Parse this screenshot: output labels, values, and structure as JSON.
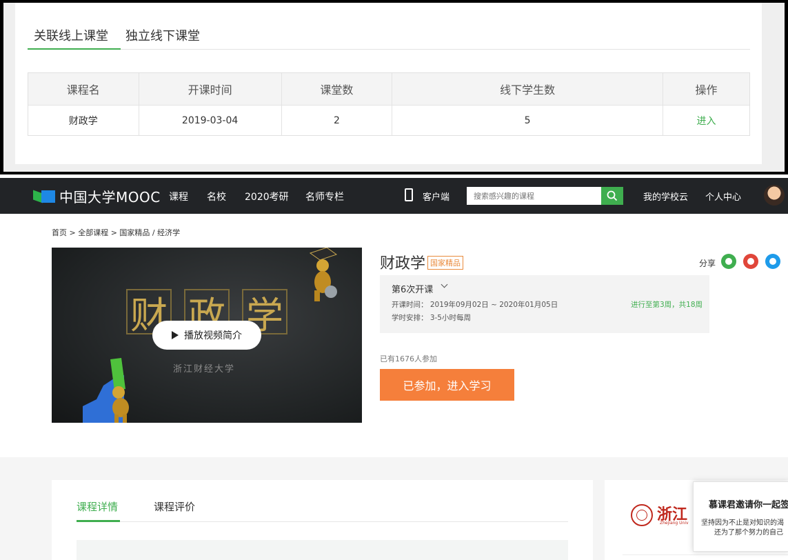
{
  "top": {
    "tabs": [
      "关联线上课堂",
      "独立线下课堂"
    ],
    "table": {
      "headers": [
        "课程名",
        "开课时间",
        "课堂数",
        "线下学生数",
        "操作"
      ],
      "rows": [
        {
          "name": "财政学",
          "date": "2019-03-04",
          "classes": "2",
          "students": "5",
          "action": "进入"
        }
      ]
    }
  },
  "mooc": {
    "logo": "中国大学MOOC",
    "nav": [
      "课程",
      "名校",
      "2020考研",
      "名师专栏"
    ],
    "client": "客户端",
    "search_placeholder": "搜索感兴趣的课程",
    "my_school": "我的学校云",
    "personal": "个人中心",
    "breadcrumb": "首页 > 全部课程 > 国家精品 / 经济学",
    "video": {
      "title_chars": [
        "财",
        "政",
        "学"
      ],
      "subtitle": "浙江财经大学",
      "play_label": "播放视频简介"
    },
    "course": {
      "title": "财政学",
      "badge": "国家精品",
      "share": "分享",
      "term": "第6次开课",
      "time": "开课时间： 2019年09月02日 ~ 2020年01月05日",
      "hours": "学时安排： 3-5小时每周",
      "progress": "进行至第3周，共18周",
      "joined": "已有1676人参加",
      "enter_button": "已参加，进入学习"
    },
    "detail_tabs": [
      "课程详情",
      "课程评价"
    ],
    "school": {
      "name": "浙江",
      "en": "Zhejiang Univ"
    },
    "invite": {
      "title": "慕课君邀请你一起签",
      "line1": "坚持因为不止是对知识的渴",
      "line2": "还为了那个努力的自己"
    }
  },
  "colors": {
    "accent": "#3fae4f",
    "cta": "#f57f3b",
    "nav_bg": "#222427",
    "badge": "#e98a3b",
    "school": "#c0281d"
  }
}
